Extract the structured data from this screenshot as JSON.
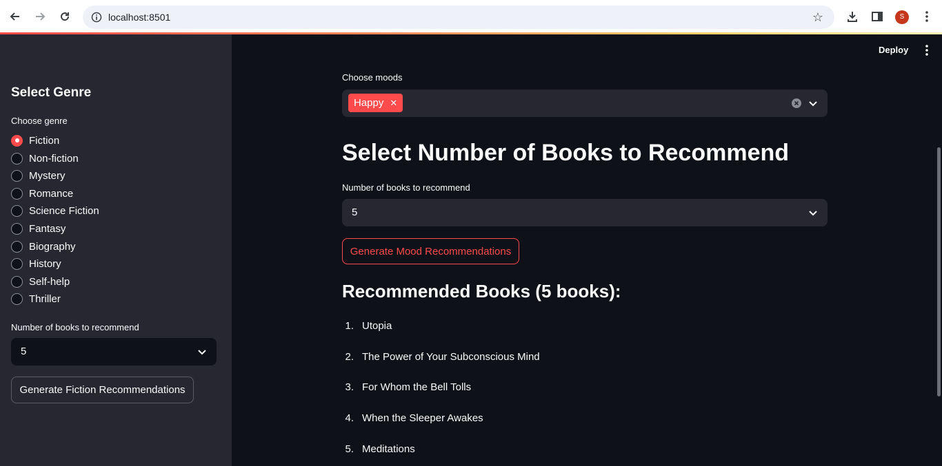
{
  "browser": {
    "url": "localhost:8501",
    "profile_initial": "S"
  },
  "app": {
    "deploy_label": "Deploy"
  },
  "sidebar": {
    "title": "Select Genre",
    "genre_label": "Choose genre",
    "genres": [
      "Fiction",
      "Non-fiction",
      "Mystery",
      "Romance",
      "Science Fiction",
      "Fantasy",
      "Biography",
      "History",
      "Self-help",
      "Thriller"
    ],
    "selected_genre": "Fiction",
    "count_label": "Number of books to recommend",
    "count_value": "5",
    "button_label": "Generate Fiction Recommendations"
  },
  "main": {
    "moods_label": "Choose moods",
    "selected_moods": [
      "Happy"
    ],
    "heading": "Select Number of Books to Recommend",
    "count_label": "Number of books to recommend",
    "count_value": "5",
    "button_label": "Generate Mood Recommendations",
    "results_heading": "Recommended Books (5 books):",
    "books": [
      "Utopia",
      "The Power of Your Subconscious Mind",
      "For Whom the Bell Tolls",
      "When the Sleeper Awakes",
      "Meditations"
    ]
  },
  "colors": {
    "accent": "#ff4b4b",
    "background": "#0e1117",
    "sidebar": "#262730",
    "text": "#fafafa"
  }
}
